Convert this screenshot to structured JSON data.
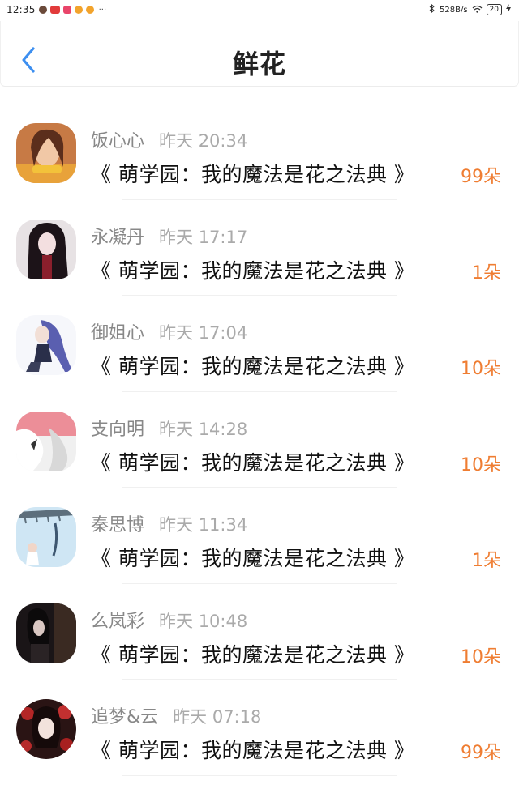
{
  "status_bar": {
    "time": "12:35",
    "dots": "···",
    "net_speed": "528B/s",
    "battery": "20"
  },
  "header": {
    "title": "鲜花"
  },
  "rows": [
    {
      "name": "饭心心",
      "time": "昨天 20:34",
      "book": "《 萌学园：我的魔法是花之法典 》",
      "amount": "99朵"
    },
    {
      "name": "永凝丹",
      "time": "昨天 17:17",
      "book": "《 萌学园：我的魔法是花之法典 》",
      "amount": "1朵"
    },
    {
      "name": "御姐心",
      "time": "昨天 17:04",
      "book": "《 萌学园：我的魔法是花之法典 》",
      "amount": "10朵"
    },
    {
      "name": "支向明",
      "time": "昨天 14:28",
      "book": "《 萌学园：我的魔法是花之法典 》",
      "amount": "10朵"
    },
    {
      "name": "秦思博",
      "time": "昨天 11:34",
      "book": "《 萌学园：我的魔法是花之法典 》",
      "amount": "1朵"
    },
    {
      "name": "么岚彩",
      "time": "昨天 10:48",
      "book": "《 萌学园：我的魔法是花之法典 》",
      "amount": "10朵"
    },
    {
      "name": "追梦&云",
      "time": "昨天 07:18",
      "book": "《 萌学园：我的魔法是花之法典 》",
      "amount": "99朵"
    }
  ],
  "colors": {
    "accent_back": "#3d8ff0",
    "amount": "#ef7d32"
  }
}
